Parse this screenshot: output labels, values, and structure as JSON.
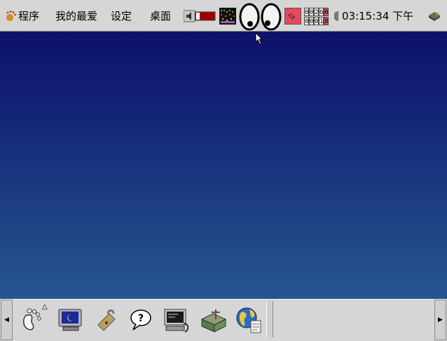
{
  "top_panel": {
    "menu": [
      {
        "label": "程序",
        "icon": "gnome-foot-icon"
      },
      {
        "label": "我的最爱"
      },
      {
        "label": "设定"
      },
      {
        "label": "桌面"
      }
    ],
    "clock": "03:15:34 下午",
    "counter": {
      "top": [
        "0",
        "0",
        "2",
        "6",
        "0"
      ],
      "bottom": [
        "0",
        "0",
        "0",
        "1",
        "8"
      ]
    },
    "applets": [
      "volume-icon",
      "cpu-load-icon",
      "eyes-icon",
      "network-monitor-icon",
      "counter-icon",
      "clock-icon",
      "tray-icon"
    ]
  },
  "bottom_panel": {
    "launchers": [
      {
        "name": "gnome-menu-icon"
      },
      {
        "name": "monitor-icon"
      },
      {
        "name": "lock-icon"
      },
      {
        "name": "help-icon"
      },
      {
        "name": "terminal-icon"
      },
      {
        "name": "toolbox-icon"
      },
      {
        "name": "browser-globe-icon"
      }
    ],
    "left_arrow": "◀",
    "right_arrow": "▶"
  },
  "colors": {
    "desktop_top": "#0d116a",
    "desktop_bottom": "#26568f",
    "panel": "#d6d6d6"
  }
}
